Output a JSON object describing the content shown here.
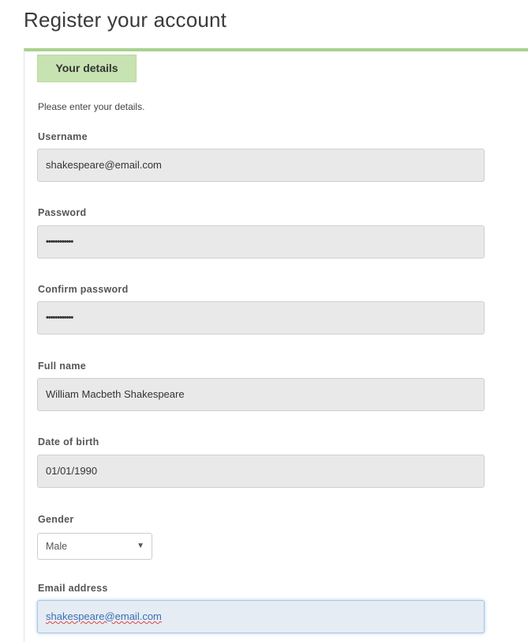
{
  "page": {
    "title": "Register your account"
  },
  "section": {
    "tab_label": "Your details",
    "intro": "Please enter your details."
  },
  "form": {
    "username": {
      "label": "Username",
      "value": "shakespeare@email.com"
    },
    "password": {
      "label": "Password",
      "value": "••••••••••••"
    },
    "confirm_password": {
      "label": "Confirm password",
      "value": "••••••••••••"
    },
    "full_name": {
      "label": "Full name",
      "value": "William Macbeth Shakespeare"
    },
    "date_of_birth": {
      "label": "Date of birth",
      "value": "01/01/1990"
    },
    "gender": {
      "label": "Gender",
      "selected": "Male",
      "arrow_icon": "▼"
    },
    "email": {
      "label": "Email address",
      "value": "shakespeare@email.com"
    }
  },
  "colors": {
    "accent_green": "#a9d18e",
    "tab_green": "#c7e3b1",
    "input_bg": "#e9e9e9",
    "focus_blue": "#a8c6e6"
  }
}
